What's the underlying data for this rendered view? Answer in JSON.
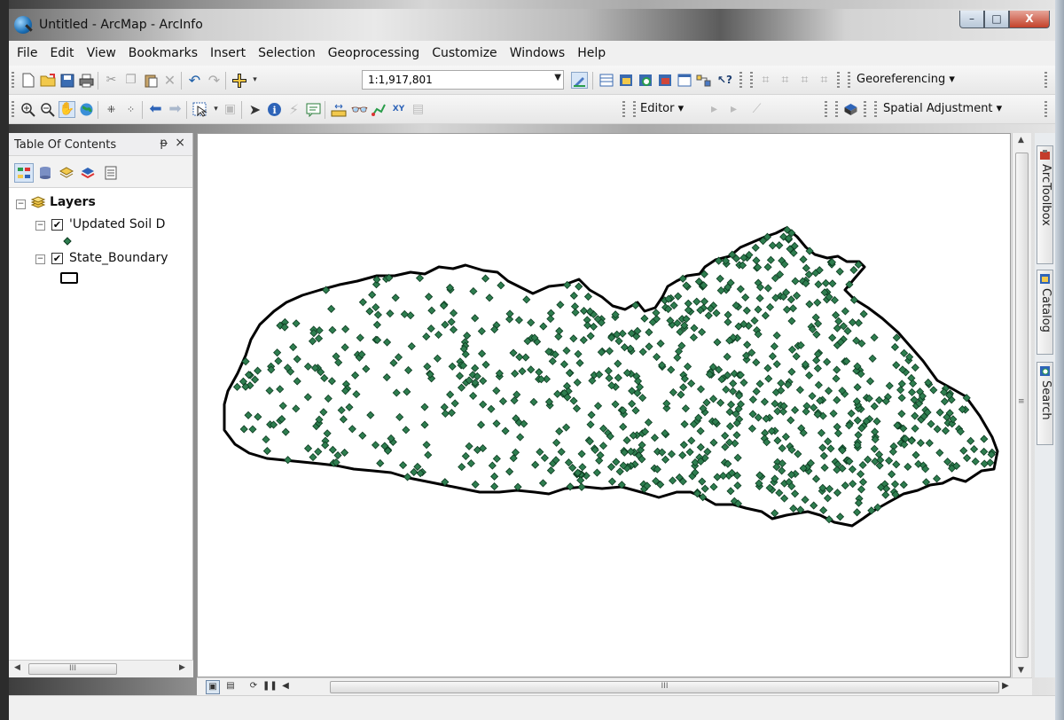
{
  "window": {
    "title": "Untitled - ArcMap - ArcInfo",
    "minimize": "–",
    "maximize": "□",
    "close": "X"
  },
  "menu": [
    "File",
    "Edit",
    "View",
    "Bookmarks",
    "Insert",
    "Selection",
    "Geoprocessing",
    "Customize",
    "Windows",
    "Help"
  ],
  "toolbar": {
    "scale_value": "1:1,917,801",
    "georeferencing_label": "Georeferencing ▾",
    "editor_label": "Editor ▾",
    "spatial_adjustment_label": "Spatial Adjustment ▾",
    "help_label": "?"
  },
  "toc": {
    "title": "Table Of Contents",
    "pin": "ᵽ",
    "close": "×",
    "root": {
      "label": "Layers",
      "expander": "−"
    },
    "layers": [
      {
        "label": "'Updated Soil D",
        "checked": "✔",
        "expander": "−",
        "symbol": "point"
      },
      {
        "label": "State_Boundary",
        "checked": "✔",
        "expander": "−",
        "symbol": "polygon"
      }
    ],
    "scroll_thumb": "III"
  },
  "map": {
    "boundary_color": "#000000",
    "point_fill": "#2e7d4f",
    "point_stroke": "#0b3a1f",
    "scroll_thumb": "III",
    "vscroll_grip": "≡"
  },
  "dock": {
    "tabs": [
      "ArcToolbox",
      "Catalog",
      "Search"
    ]
  },
  "colors": {
    "accent": "#d7e6f7",
    "menu_bg": "#f0f0f0"
  }
}
